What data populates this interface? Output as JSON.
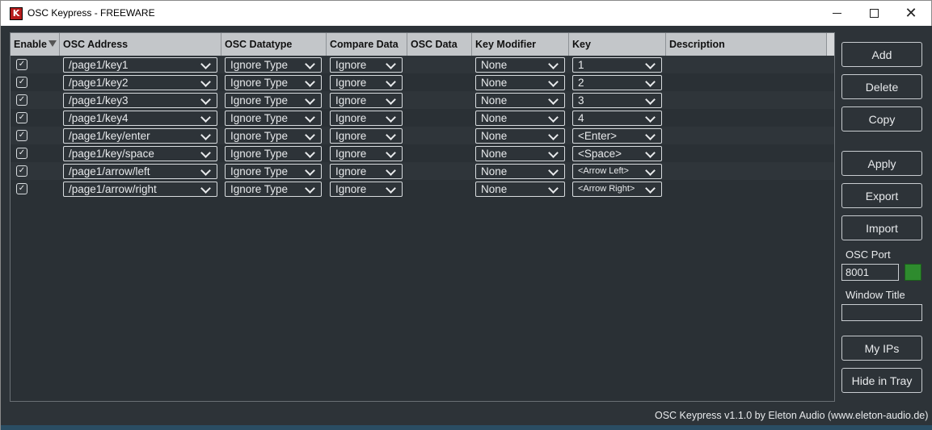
{
  "window": {
    "icon_letter": "K",
    "title": "OSC Keypress - FREEWARE"
  },
  "table": {
    "headers": [
      "Enable",
      "OSC Address",
      "OSC Datatype",
      "Compare Data",
      "OSC Data",
      "Key Modifier",
      "Key",
      "Description"
    ],
    "sorted_column": "Enable",
    "rows": [
      {
        "enabled": true,
        "address": "/page1/key1",
        "datatype": "Ignore Type",
        "compare": "Ignore",
        "osc_data": "",
        "modifier": "None",
        "key": "1",
        "description": ""
      },
      {
        "enabled": true,
        "address": "/page1/key2",
        "datatype": "Ignore Type",
        "compare": "Ignore",
        "osc_data": "",
        "modifier": "None",
        "key": "2",
        "description": ""
      },
      {
        "enabled": true,
        "address": "/page1/key3",
        "datatype": "Ignore Type",
        "compare": "Ignore",
        "osc_data": "",
        "modifier": "None",
        "key": "3",
        "description": ""
      },
      {
        "enabled": true,
        "address": "/page1/key4",
        "datatype": "Ignore Type",
        "compare": "Ignore",
        "osc_data": "",
        "modifier": "None",
        "key": "4",
        "description": ""
      },
      {
        "enabled": true,
        "address": "/page1/key/enter",
        "datatype": "Ignore Type",
        "compare": "Ignore",
        "osc_data": "",
        "modifier": "None",
        "key": "<Enter>",
        "description": ""
      },
      {
        "enabled": true,
        "address": "/page1/key/space",
        "datatype": "Ignore Type",
        "compare": "Ignore",
        "osc_data": "",
        "modifier": "None",
        "key": "<Space>",
        "description": ""
      },
      {
        "enabled": true,
        "address": "/page1/arrow/left",
        "datatype": "Ignore Type",
        "compare": "Ignore",
        "osc_data": "",
        "modifier": "None",
        "key": "<Arrow Left>",
        "description": ""
      },
      {
        "enabled": true,
        "address": "/page1/arrow/right",
        "datatype": "Ignore Type",
        "compare": "Ignore",
        "osc_data": "",
        "modifier": "None",
        "key": "<Arrow Right>",
        "description": ""
      }
    ]
  },
  "sidebar": {
    "add_label": "Add",
    "delete_label": "Delete",
    "copy_label": "Copy",
    "apply_label": "Apply",
    "export_label": "Export",
    "import_label": "Import",
    "osc_port_label": "OSC Port",
    "osc_port_value": "8001",
    "osc_port_status": "active",
    "osc_port_status_color": "#2e8b2e",
    "window_title_label": "Window Title",
    "window_title_value": "",
    "my_ips_label": "My IPs",
    "hide_tray_label": "Hide in Tray"
  },
  "footer": {
    "text": "OSC Keypress v1.1.0 by Eleton Audio (www.eleton-audio.de)"
  },
  "icons": {
    "app": "app-logo-icon",
    "minimize": "minimize-icon",
    "maximize": "maximize-icon",
    "close": "close-icon",
    "dropdown": "chevron-down-icon",
    "checkbox": "checkmark-icon",
    "sort": "sort-down-icon"
  },
  "colors": {
    "background": "#2d3338",
    "header": "#c3c6c9",
    "text": "#e8eaec",
    "status_ok": "#2e8b2e"
  }
}
